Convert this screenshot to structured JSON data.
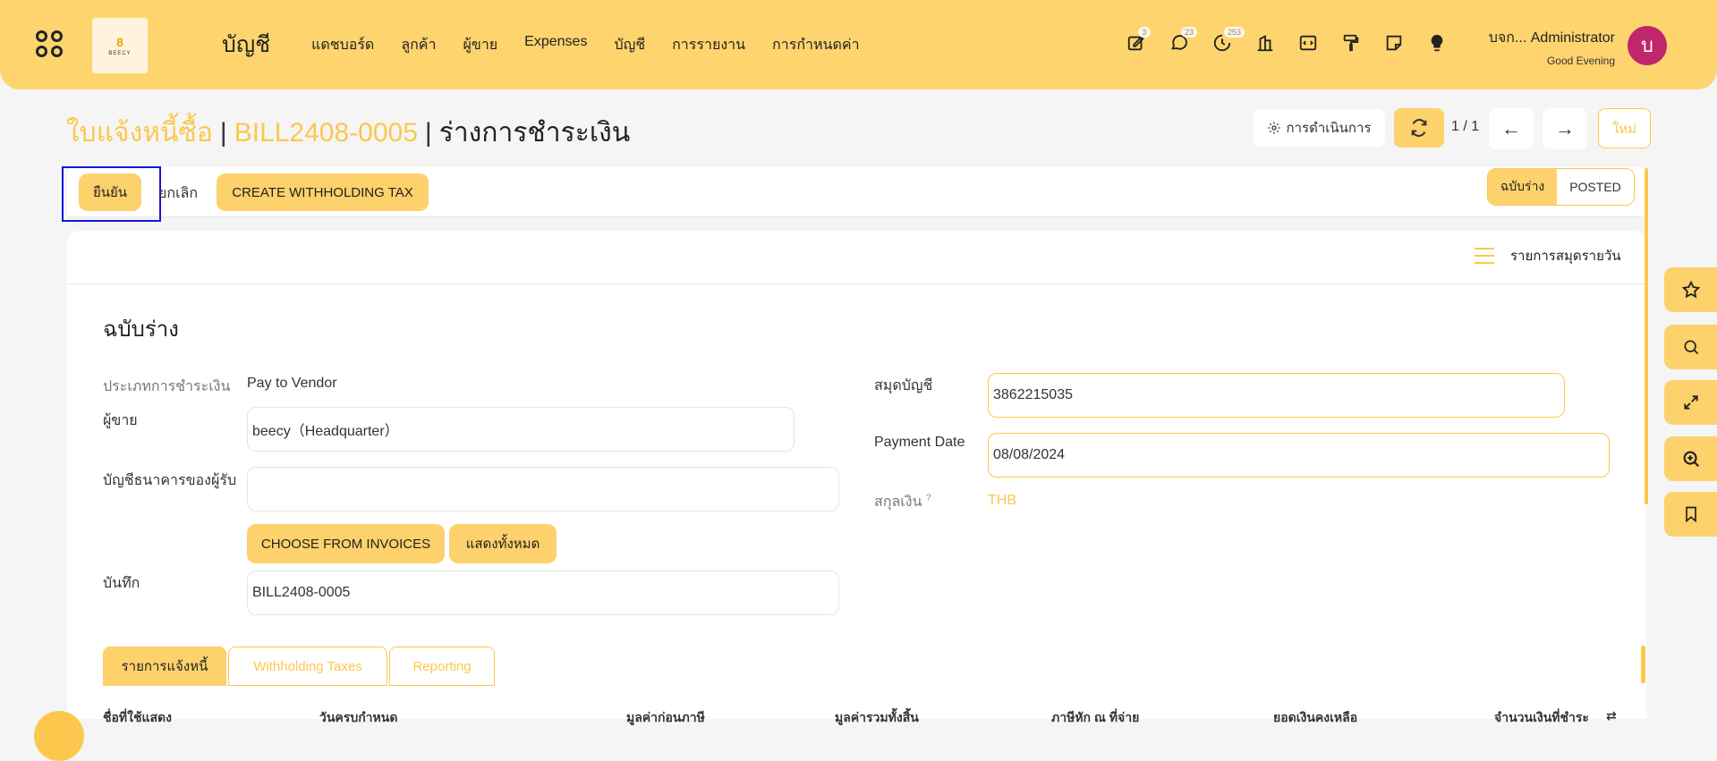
{
  "app": {
    "name": "บัญชี",
    "logo_text": "BEECY",
    "logo_glyph": "8"
  },
  "menu": [
    "แดชบอร์ด",
    "ลูกค้า",
    "ผู้ขาย",
    "Expenses",
    "บัญชี",
    "การรายงาน",
    "การกำหนดค่า"
  ],
  "systray": {
    "activities_count": "3",
    "messages_count": "23",
    "timesheet_count": "253"
  },
  "user": {
    "name": "บจก... Administrator",
    "greeting": "Good Evening",
    "avatar_letter": "บ"
  },
  "breadcrumb": {
    "root": "ใบแจ้งหนี้ซื้อ",
    "record": "BILL2408-0005",
    "current": "ร่างการชำระเงิน",
    "separator": "|"
  },
  "control": {
    "action_label": "การดำเนินการ",
    "pager": "1 / 1",
    "new_label": "ใหม่"
  },
  "statusbar": {
    "confirm": "ยืนยัน",
    "cancel": "ยกเลิก",
    "wht": "CREATE WITHHOLDING TAX",
    "states": [
      "ฉบับร่าง",
      "POSTED"
    ]
  },
  "sheet": {
    "journal_button": "รายการสมุดรายวัน",
    "title": "ฉบับร่าง"
  },
  "fields": {
    "payment_type_label": "ประเภทการชำระเงิน",
    "payment_type": "Pay to Vendor",
    "vendor_label": "ผู้ขาย",
    "vendor": "beecy（Headquarter）",
    "bank_label": "บัญชีธนาคารของผู้รับ",
    "bank": "",
    "choose_invoices": "CHOOSE FROM INVOICES",
    "show_all": "แสดงทั้งหมด",
    "memo_label": "บันทึก",
    "memo": "BILL2408-0005",
    "journal_label": "สมุดบัญชี",
    "journal": "3862215035",
    "date_label": "Payment Date",
    "date": "08/08/2024",
    "currency_label": "สกุลเงิน",
    "currency_help": "?",
    "currency": "THB"
  },
  "tabs": [
    "รายการแจ้งหนี้",
    "Withholding Taxes",
    "Reporting"
  ],
  "columns": [
    "ชื่อที่ใช้แสดง",
    "วันครบกำหนด",
    "มูลค่าก่อนภาษี",
    "มูลค่ารวมทั้งสิ้น",
    "ภาษีหัก ณ ที่จ่าย",
    "ยอดเงินคงเหลือ",
    "จำนวนเงินที่ชำระ"
  ],
  "colors": {
    "accent": "#fed46e",
    "accent_text": "#fbc84d",
    "avatar": "#c0266b",
    "highlight": "#1515d8"
  }
}
